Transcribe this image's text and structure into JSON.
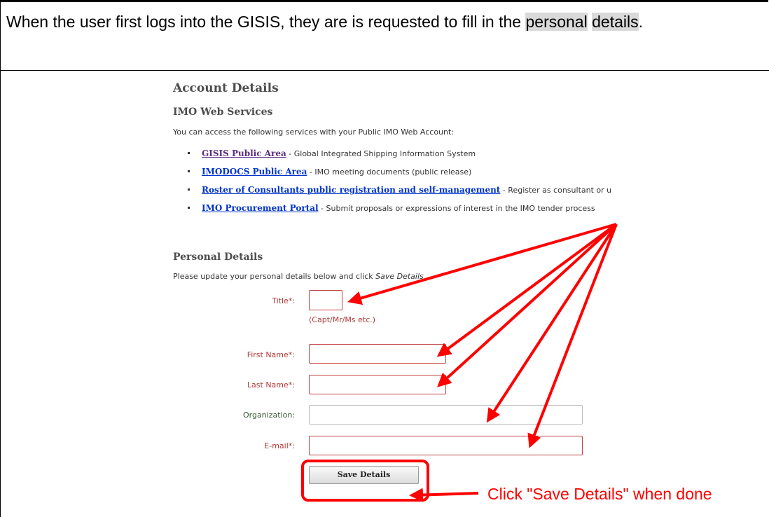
{
  "intro": {
    "text_before": "When the user first logs into the GISIS, they are is requested to fill in the ",
    "highlight1": "personal",
    "text_mid": " ",
    "highlight2": "details",
    "text_after": "."
  },
  "screenshot": {
    "account_heading": "Account Details",
    "imo_heading": "IMO Web Services",
    "access_text": "You can access the following services with your Public IMO Web Account:",
    "services": [
      {
        "link": "GISIS Public Area",
        "desc": " - Global Integrated Shipping Information System"
      },
      {
        "link": "IMODOCS Public Area",
        "desc": " - IMO meeting documents (public release)"
      },
      {
        "link": "Roster of Consultants public registration and self-management",
        "desc": " - Register as consultant or u"
      },
      {
        "link": "IMO Procurement Portal",
        "desc": " - Submit proposals or expressions of interest in the IMO tender process"
      }
    ],
    "personal_heading": "Personal Details",
    "instr_text": "Please update your personal details below and click ",
    "instr_emph": "Save Details",
    "form": {
      "title_label": "Title*:",
      "title_hint": "(Capt/Mr/Ms etc.)",
      "first_name_label": "First Name*:",
      "last_name_label": "Last Name*:",
      "organization_label": "Organization:",
      "email_label": "E-mail*:",
      "title_value": "",
      "first_name_value": "",
      "last_name_value": "",
      "organization_value": "",
      "email_value": "",
      "save_label": "Save Details"
    }
  },
  "annotation": {
    "callout_text": "Click \"Save Details\" when done",
    "color": "#ff0000"
  }
}
